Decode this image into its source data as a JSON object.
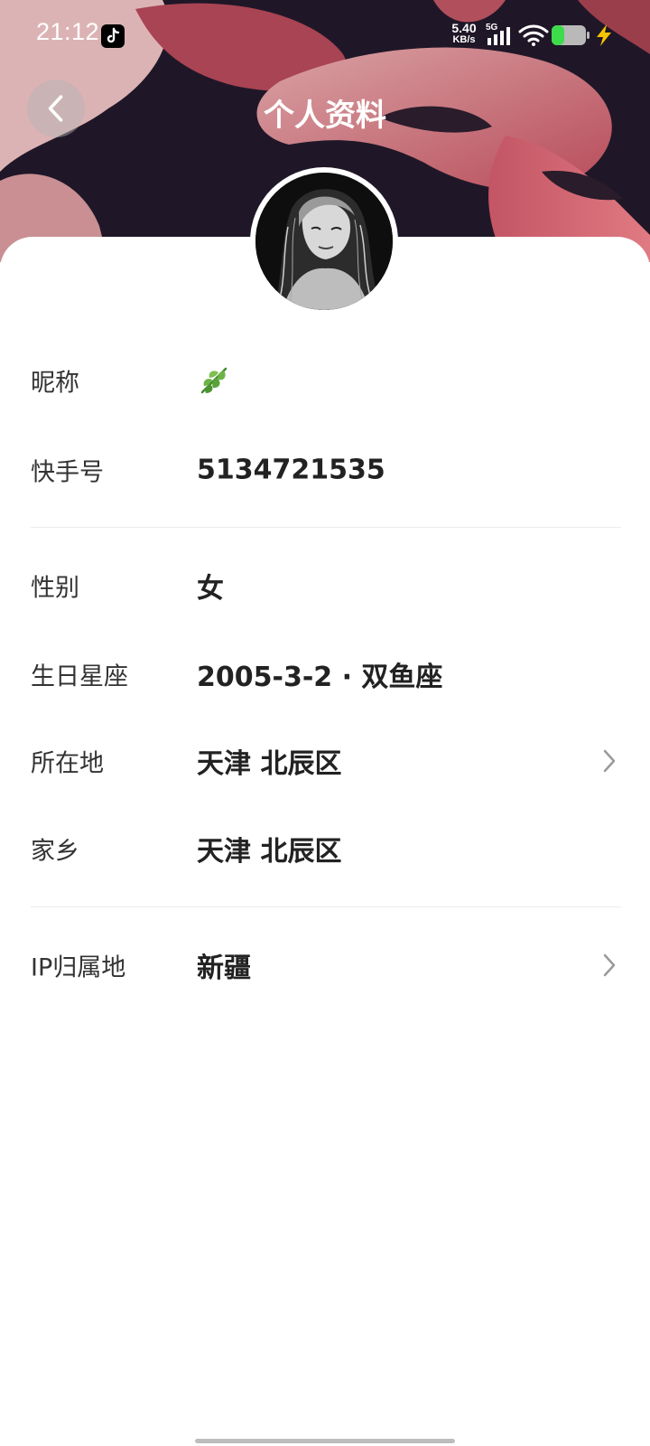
{
  "status_bar": {
    "time": "21:12",
    "net_speed_value": "5.40",
    "net_speed_unit": "KB/s",
    "network_type": "5G",
    "app_icon": "tiktok-icon",
    "battery_color": "#3ddc4a",
    "charge_color": "#f5c400"
  },
  "nav": {
    "back_icon": "chevron-left-icon",
    "title": "个人资料"
  },
  "profile": {
    "avatar": "avatar-image",
    "rows": [
      {
        "label": "昵称",
        "value": "",
        "value_icon": "leaf-icon",
        "has_chevron": false
      },
      {
        "label": "快手号",
        "value": "5134721535",
        "has_chevron": false
      },
      {
        "label": "性别",
        "value": "女",
        "has_chevron": false
      },
      {
        "label": "生日星座",
        "value": "2005-3-2 · 双鱼座",
        "has_chevron": false
      },
      {
        "label": "所在地",
        "value": "天津 北辰区",
        "has_chevron": true
      },
      {
        "label": "家乡",
        "value": "天津 北辰区",
        "has_chevron": false
      },
      {
        "label": "IP归属地",
        "value": "新疆",
        "has_chevron": true
      }
    ]
  },
  "colors": {
    "header_accent": "#c85a66",
    "label_text": "#333333",
    "value_text": "#222222",
    "divider": "#ececec"
  }
}
